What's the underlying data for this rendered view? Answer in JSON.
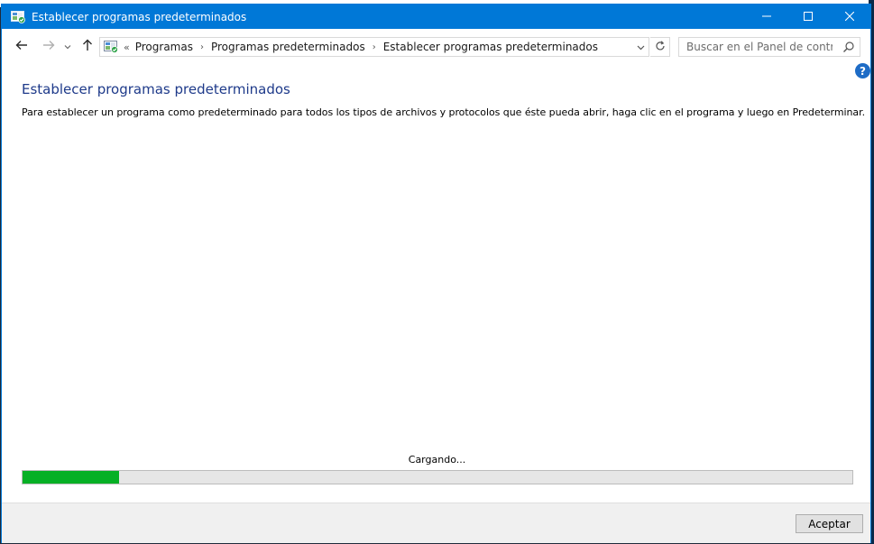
{
  "window": {
    "title": "Establecer programas predeterminados",
    "accent_color": "#0078d7",
    "controls": {
      "minimize": "minimize-icon",
      "maximize": "maximize-icon",
      "close": "close-icon"
    }
  },
  "navigation": {
    "back": "back-arrow-icon",
    "forward": "forward-arrow-icon",
    "recent": "chevron-down-icon",
    "up": "up-arrow-icon",
    "breadcrumb_prefix": "«",
    "breadcrumbs": [
      "Programas",
      "Programas predeterminados",
      "Establecer programas predeterminados"
    ],
    "separator": "›"
  },
  "search": {
    "placeholder": "Buscar en el Panel de control"
  },
  "content": {
    "title": "Establecer programas predeterminados",
    "description": "Para establecer un programa como predeterminado para todos los tipos de archivos y protocolos que éste pueda abrir, haga clic en el programa y luego en Predeterminar.",
    "title_color": "#1e3a8a"
  },
  "progress": {
    "label": "Cargando...",
    "value_fraction": 0.116,
    "fill_color": "#06b025"
  },
  "footer": {
    "ok_label": "Aceptar"
  }
}
